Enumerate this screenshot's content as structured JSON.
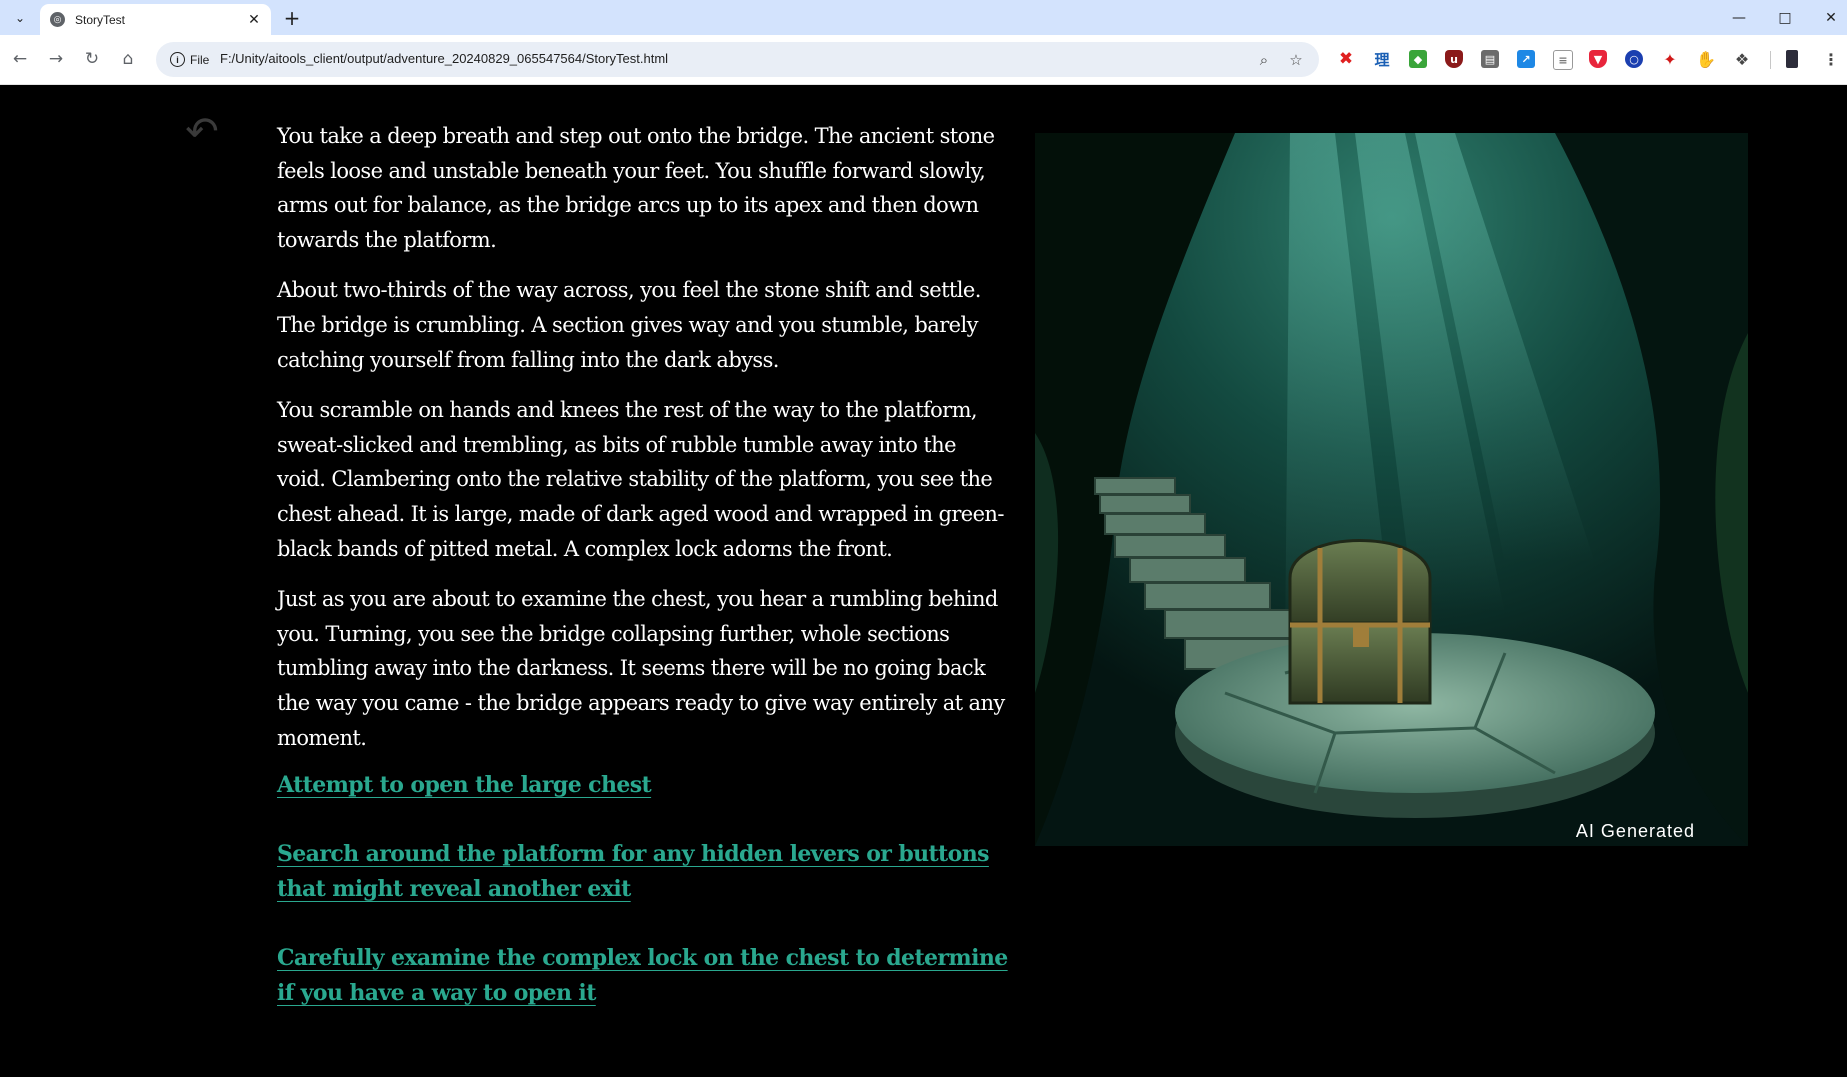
{
  "browser": {
    "tab_title": "StoryTest",
    "chip_label": "File",
    "url": "F:/Unity/aitools_client/output/adventure_20240829_065547564/StoryTest.html",
    "window_controls": [
      "minimize",
      "maximize",
      "close"
    ],
    "extensions": [
      "x-ext",
      "li-ext",
      "green-ext",
      "shield-ext",
      "folder-ext",
      "blue-arrow-ext",
      "doc-ext",
      "brave-ext",
      "circle-ext",
      "red-swirl-ext",
      "red-thumb-ext",
      "puzzle-ext",
      "profile-ext"
    ]
  },
  "story": {
    "paragraphs": [
      "You take a deep breath and step out onto the bridge. The ancient stone feels loose and unstable beneath your feet. You shuffle forward slowly, arms out for balance, as the bridge arcs up to its apex and then down towards the platform.",
      "About two-thirds of the way across, you feel the stone shift and settle. The bridge is crumbling. A section gives way and you stumble, barely catching yourself from falling into the dark abyss.",
      "You scramble on hands and knees the rest of the way to the platform, sweat-slicked and trembling, as bits of rubble tumble away into the void. Clambering onto the relative stability of the platform, you see the chest ahead. It is large, made of dark aged wood and wrapped in green-black bands of pitted metal. A complex lock adorns the front.",
      "Just as you are about to examine the chest, you hear a rumbling behind you. Turning, you see the bridge collapsing further, whole sections tumbling away into the darkness. It seems there will be no going back the way you came - the bridge appears ready to give way entirely at any moment."
    ],
    "choices": [
      "Attempt to open the large chest",
      "Search around the platform for any hidden levers or buttons that might reveal another exit",
      "Carefully examine the complex lock on the chest to determine if you have a way to open it"
    ],
    "image_badge": "AI Generated"
  },
  "colors": {
    "page_background": "#000000",
    "story_text": "#ffffff",
    "choice_link": "#2aa88f",
    "tabbar": "#d3e3fd"
  }
}
